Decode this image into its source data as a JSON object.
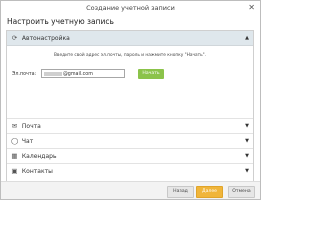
{
  "window": {
    "title": "Создание учетной записи",
    "close_glyph": "✕"
  },
  "page_title": "Настроить учетную запись",
  "autosetup": {
    "label": "Автонастройка",
    "icon": "refresh-icon",
    "icon_glyph": "⟳",
    "chevron": "▲",
    "instruction": "Введите свой адрес эл.почты, пароль и нажмите кнопку \"Начать\".",
    "email_label": "Эл.почта:",
    "email_value": "@gmail.com",
    "start_label": "Начать"
  },
  "sections": [
    {
      "label": "Почта",
      "icon": "envelope-icon",
      "icon_glyph": "✉",
      "chevron": "▼"
    },
    {
      "label": "Чат",
      "icon": "chat-bubble-icon",
      "icon_glyph": "◯",
      "chevron": "▼"
    },
    {
      "label": "Календарь",
      "icon": "calendar-icon",
      "icon_glyph": "▦",
      "chevron": "▼"
    },
    {
      "label": "Контакты",
      "icon": "contacts-icon",
      "icon_glyph": "▣",
      "chevron": "▼"
    }
  ],
  "footer": {
    "back_label": "Назад",
    "next_label": "Далее",
    "cancel_label": "Отмена"
  },
  "colors": {
    "accent_green": "#8bc34a",
    "accent_orange": "#f0b53a",
    "header_bg": "#dfe7ec"
  }
}
